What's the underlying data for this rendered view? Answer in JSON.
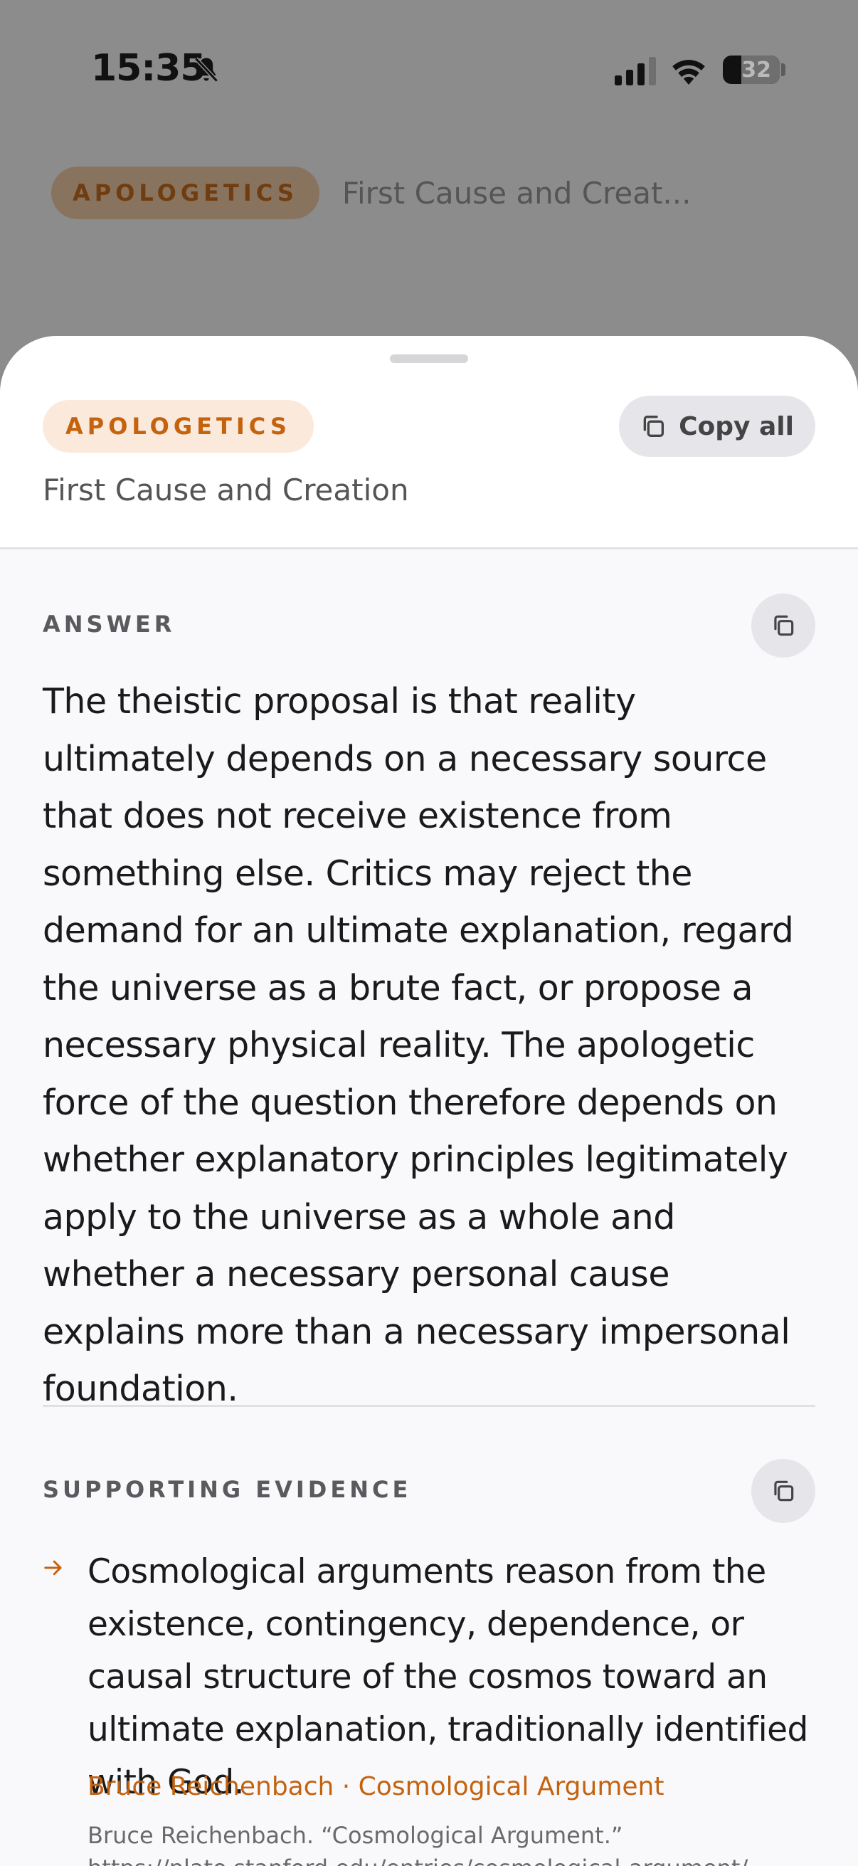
{
  "status_bar": {
    "time": "15:35",
    "battery_level": "32",
    "icons": [
      "bell-slash-icon",
      "cellular-signal-icon",
      "wifi-icon",
      "battery-icon"
    ]
  },
  "background": {
    "badge": "APOLOGETICS",
    "title": "First Cause and Creat..."
  },
  "sheet": {
    "badge": "APOLOGETICS",
    "copy_all_label": "Copy all",
    "topic_title": "First Cause and Creation",
    "answer": {
      "label": "ANSWER",
      "text": "The theistic proposal is that reality ultimately depends on a necessary source that does not receive existence from something else. Critics may reject the demand for an ultimate explanation, regard the universe as a brute fact, or propose a necessary physical reality. The apologetic force of the question therefore depends on whether explanatory principles legitimately apply to the universe as a whole and whether a necessary personal cause explains more than a necessary impersonal foundation."
    },
    "evidence": {
      "label": "SUPPORTING EVIDENCE",
      "items": [
        {
          "text": "Cosmological arguments reason from the existence, contingency, dependence, or causal structure of the cosmos toward an ultimate explanation, traditionally identified with God.",
          "source": "Bruce Reichenbach · Cosmological Argument",
          "citation": "Bruce Reichenbach. “Cosmological Argument.” https://plato.stanford.edu/entries/cosmological-argument/"
        }
      ]
    }
  },
  "colors": {
    "accent": "#c4620e",
    "badge_bg": "#fbe9db",
    "sheet_bg": "#f9f9fc",
    "dim_overlay": "#8c8c8c"
  }
}
